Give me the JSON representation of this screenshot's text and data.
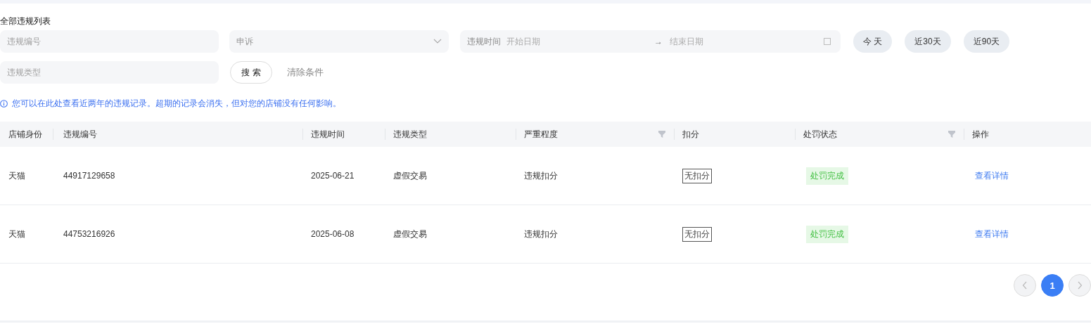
{
  "title": "全部违规列表",
  "filters": {
    "violation_id": {
      "placeholder": "违规编号"
    },
    "appeal": {
      "label": "申诉"
    },
    "date_range": {
      "label": "违规时间",
      "start_placeholder": "开始日期",
      "arrow": "→",
      "end_placeholder": "结束日期"
    },
    "quick_ranges": [
      {
        "label": "今 天"
      },
      {
        "label": "近30天"
      },
      {
        "label": "近90天"
      }
    ],
    "violation_type": {
      "placeholder": "违规类型"
    },
    "search_button": "搜 索",
    "clear_link": "清除条件"
  },
  "notice": "您可以在此处查看近两年的违规记录。超期的记录会消失，但对您的店铺没有任何影响。",
  "table": {
    "columns": [
      {
        "label": "店铺身份",
        "filter": false
      },
      {
        "label": "违规编号",
        "filter": false
      },
      {
        "label": "违规时间",
        "filter": false
      },
      {
        "label": "违规类型",
        "filter": false
      },
      {
        "label": "严重程度",
        "filter": true
      },
      {
        "label": "扣分",
        "filter": false
      },
      {
        "label": "处罚状态",
        "filter": true
      },
      {
        "label": "操作",
        "filter": false
      }
    ],
    "rows": [
      {
        "shop_identity": "天猫",
        "violation_id": "44917129658",
        "time": "2025-06-21",
        "type": "虚假交易",
        "severity": "违规扣分",
        "points": "无扣分",
        "status": "处罚完成",
        "action": "查看详情"
      },
      {
        "shop_identity": "天猫",
        "violation_id": "44753216926",
        "time": "2025-06-08",
        "type": "虚假交易",
        "severity": "违规扣分",
        "points": "无扣分",
        "status": "处罚完成",
        "action": "查看详情"
      }
    ]
  },
  "pagination": {
    "pages": [
      {
        "label": "1",
        "selected": true
      }
    ]
  }
}
